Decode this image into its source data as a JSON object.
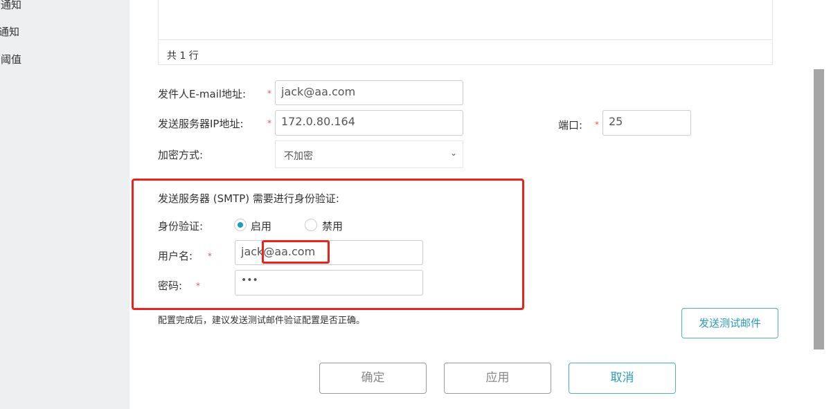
{
  "sidebar": {
    "items": [
      {
        "label": "警通知"
      },
      {
        "label": "通知"
      },
      {
        "label": "警阈值"
      }
    ]
  },
  "table": {
    "footer": "共 1 行"
  },
  "form": {
    "sender_label": "发件人E-mail地址:",
    "sender_value": "jack@aa.com",
    "ip_label": "发送服务器IP地址:",
    "ip_value": "172.0.80.164",
    "port_label": "端口:",
    "port_value": "25",
    "encrypt_label": "加密方式:",
    "encrypt_value": "不加密",
    "required_mark": "*",
    "smtp_title": "发送服务器 (SMTP) 需要进行身份验证:",
    "auth_label": "身份验证:",
    "auth_enable": "启用",
    "auth_disable": "禁用",
    "auth_selected": "启用",
    "username_label": "用户名:",
    "username_value": "jack@aa.com",
    "password_label": "密码:",
    "password_value": "•••",
    "hint": "配置完成后，建议发送测试邮件验证配置是否正确。",
    "test_button": "发送测试邮件"
  },
  "actions": {
    "ok": "确定",
    "apply": "应用",
    "cancel": "取消"
  },
  "colors": {
    "accent": "#1a9cc0",
    "highlight": "#e8231f"
  }
}
